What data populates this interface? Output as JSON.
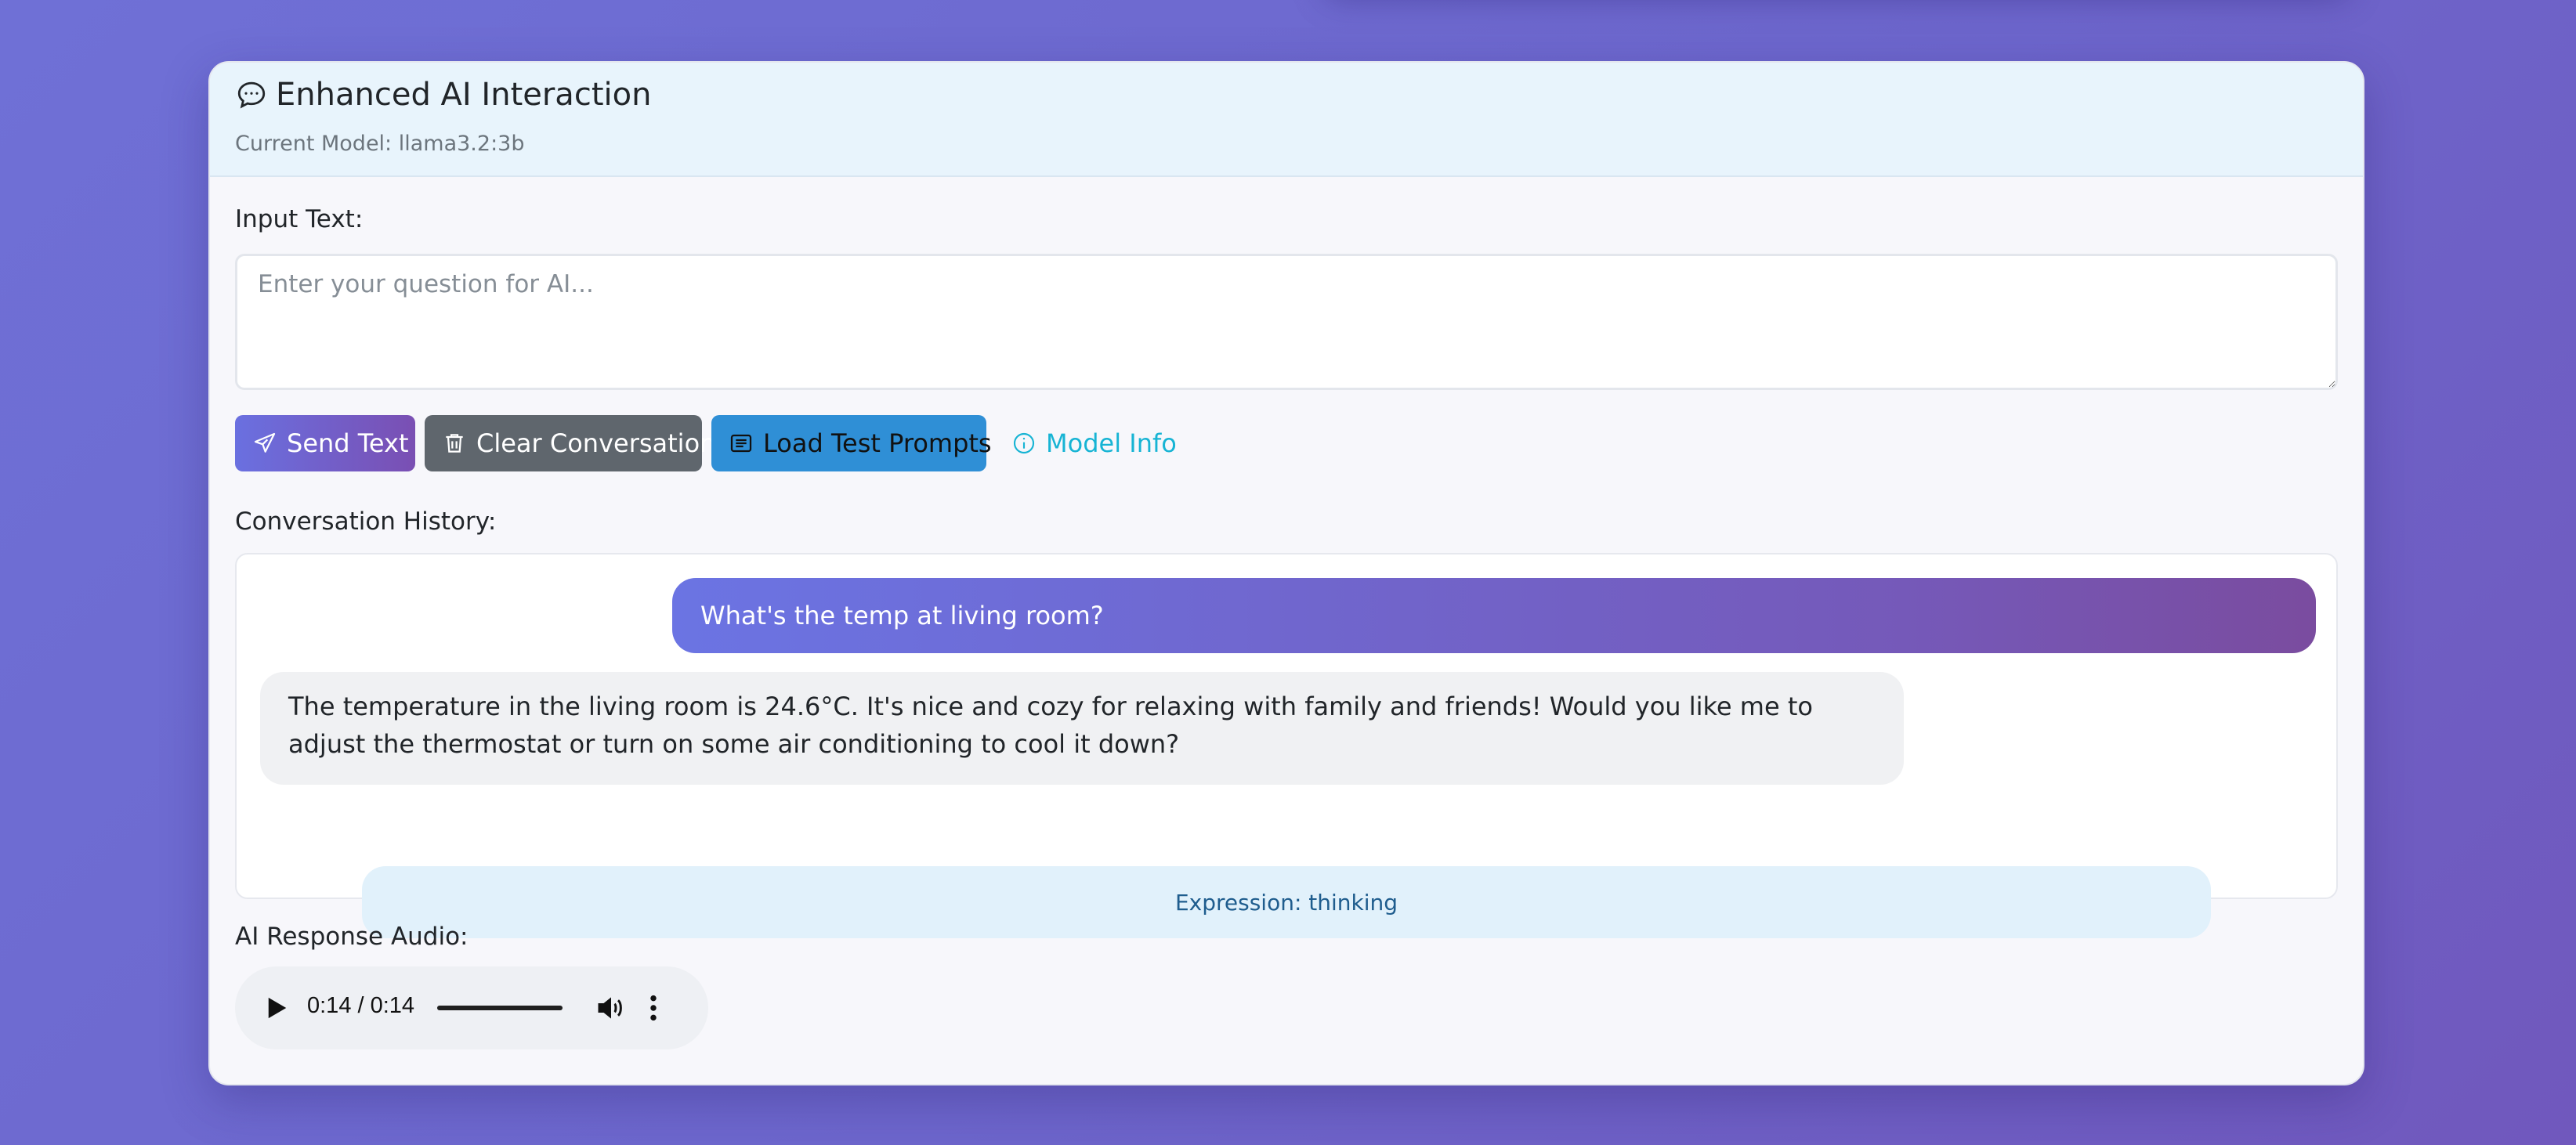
{
  "header": {
    "title": "Enhanced AI Interaction",
    "model_line": "Current Model: llama3.2:3b"
  },
  "input": {
    "label": "Input Text:",
    "placeholder": "Enter your question for AI...",
    "value": ""
  },
  "buttons": {
    "send": "Send Text",
    "clear": "Clear Conversation",
    "load": "Load Test Prompts",
    "info": "Model Info"
  },
  "history": {
    "label": "Conversation History:",
    "user_message": "What's the temp at living room?",
    "ai_message": "The temperature in the living room is 24.6°C. It's nice and cozy for relaxing with family and friends! Would you like me to adjust the thermostat or turn on some air conditioning to cool it down?",
    "expression": "Expression: thinking"
  },
  "audio": {
    "label": "AI Response Audio:",
    "time": "0:14 / 0:14",
    "progress_percent": 100
  },
  "icons": {
    "title": "speech-bubble-icon",
    "send": "send-icon",
    "clear": "trash-icon",
    "load": "list-icon",
    "info": "info-icon",
    "play": "play-icon",
    "volume": "volume-icon",
    "more": "more-vertical-icon"
  },
  "colors": {
    "background": "#6f6ad3",
    "header_bg": "#e8f4fc",
    "send_button": "#6a70e0",
    "clear_button": "#5f666d",
    "load_button": "#2f8fd6",
    "info_link": "#17b4d4",
    "user_bubble": "#6b74e3",
    "ai_bubble": "#f0f1f3",
    "expression_bg": "#e1f1fb"
  }
}
